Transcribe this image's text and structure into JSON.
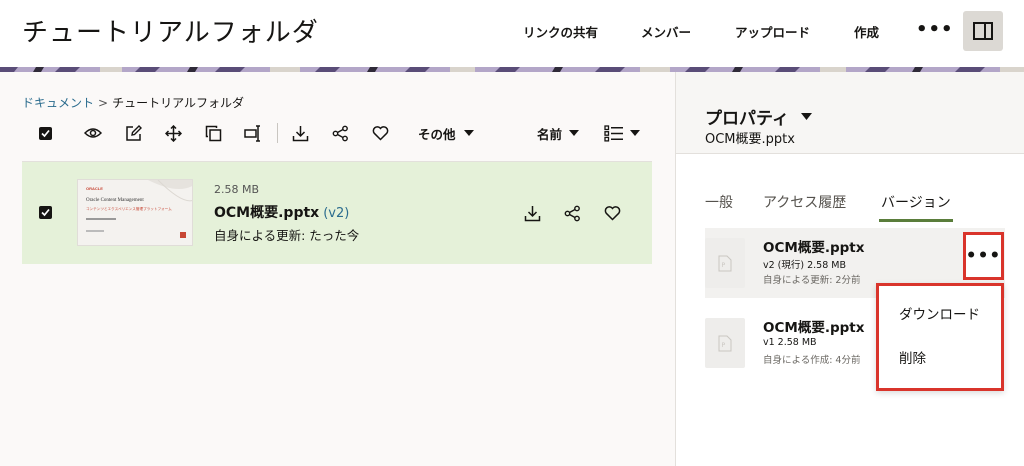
{
  "header": {
    "title": "チュートリアルフォルダ",
    "nav": [
      "リンクの共有",
      "メンバー",
      "アップロード",
      "作成"
    ],
    "more": "•••"
  },
  "breadcrumb": {
    "root": "ドキュメント",
    "sep": ">",
    "current": "チュートリアルフォルダ"
  },
  "toolbar": {
    "more_label": "その他",
    "sort_label": "名前"
  },
  "file": {
    "size": "2.58 MB",
    "name": "OCM概要.pptx",
    "version": "(v2)",
    "updated": "自身による更新: たった今",
    "thumb": {
      "brand": "ORACLE",
      "title": "Oracle Content Management",
      "subtitle": "コンテンツとエクスペリエンス管理プラットフォーム"
    }
  },
  "panel": {
    "title": "プロパティ",
    "file": "OCM概要.pptx",
    "tabs": [
      "一般",
      "アクセス履歴",
      "バージョン"
    ],
    "active_tab": 2,
    "versions": [
      {
        "name": "OCM概要.pptx",
        "meta": "v2 (現行) 2.58 MB",
        "updated": "自身による更新: 2分前"
      },
      {
        "name": "OCM概要.pptx",
        "meta": "v1 2.58 MB",
        "updated": "自身による作成: 4分前"
      }
    ]
  },
  "version_menu": {
    "more": "•••",
    "items": [
      "ダウンロード",
      "削除"
    ]
  },
  "colors": {
    "selected_row": "#e5f1d9",
    "link": "#2b6c8e",
    "highlight": "#d9342b",
    "tab_active": "#5a7d3b"
  }
}
